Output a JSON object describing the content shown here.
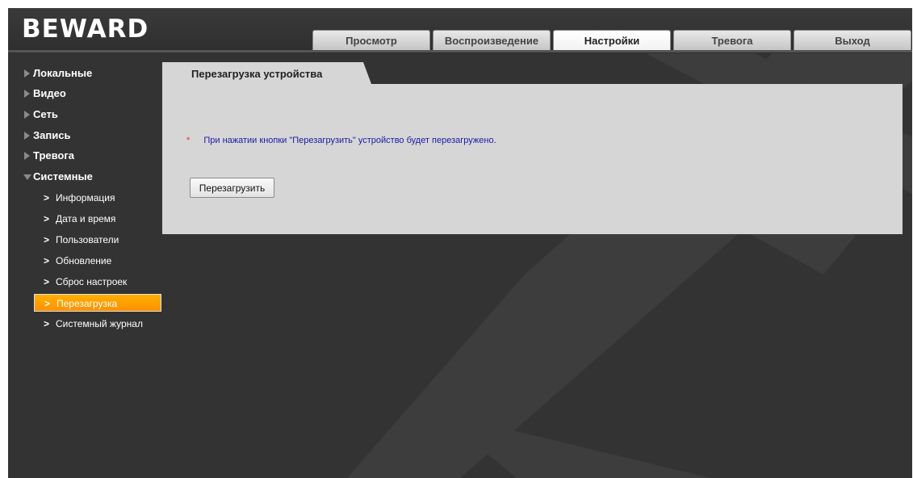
{
  "brand": {
    "logo_text": "BEWARD"
  },
  "nav": {
    "tabs": [
      {
        "label": "Просмотр",
        "active": false
      },
      {
        "label": "Воспроизведение",
        "active": false
      },
      {
        "label": "Настройки",
        "active": true
      },
      {
        "label": "Тревога",
        "active": false
      },
      {
        "label": "Выход",
        "active": false
      }
    ]
  },
  "sidebar": {
    "categories": [
      {
        "label": "Локальные",
        "expanded": false
      },
      {
        "label": "Видео",
        "expanded": false
      },
      {
        "label": "Сеть",
        "expanded": false
      },
      {
        "label": "Запись",
        "expanded": false
      },
      {
        "label": "Тревога",
        "expanded": false
      },
      {
        "label": "Системные",
        "expanded": true
      }
    ],
    "items": [
      {
        "label": "Информация",
        "active": false
      },
      {
        "label": "Дата и время",
        "active": false
      },
      {
        "label": "Пользователи",
        "active": false
      },
      {
        "label": "Обновление",
        "active": false
      },
      {
        "label": "Сброс настроек",
        "active": false
      },
      {
        "label": "Перезагрузка",
        "active": true
      },
      {
        "label": "Системный журнал",
        "active": false
      }
    ],
    "chevron_glyph": ">"
  },
  "main": {
    "panel_title": "Перезагрузка устройства",
    "note_marker": "*",
    "note_text": "При нажатии кнопки \"Перезагрузить\" устройство будет перезагружено.",
    "reboot_button_label": "Перезагрузить"
  },
  "colors": {
    "background": "#333333",
    "panel": "#d6d6d6",
    "accent": "#ff9d00",
    "note_text": "#1a1aa6",
    "note_marker": "#e03030"
  },
  "icons": {
    "category_collapsed": "triangle-right-icon",
    "category_expanded": "triangle-down-icon",
    "item": "chevron-right-icon"
  }
}
